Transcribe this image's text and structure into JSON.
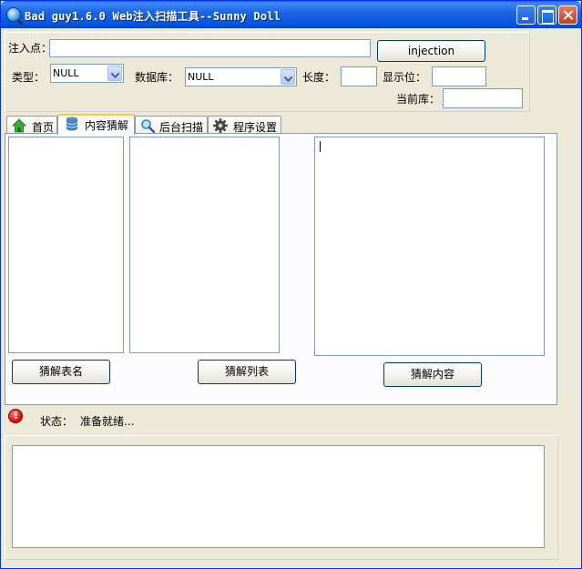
{
  "window": {
    "title": "Bad guy1.6.0 Web注入扫描工具--Sunny Doll"
  },
  "form": {
    "inject_point_label": "注入点：",
    "inject_point_value": "",
    "injection_button": "injection",
    "type_label": "类型：",
    "type_value": "NULL",
    "database_label": "数据库：",
    "database_value": "NULL",
    "length_label": "长度：",
    "length_value": "",
    "display_pos_label": "显示位：",
    "display_pos_value": "",
    "current_db_label": "当前库：",
    "current_db_value": ""
  },
  "tabs": [
    {
      "label": "首页",
      "icon": "home-icon"
    },
    {
      "label": "内容猜解",
      "icon": "database-icon",
      "active": true
    },
    {
      "label": "后台扫描",
      "icon": "magnifier-icon"
    },
    {
      "label": "程序设置",
      "icon": "gear-icon"
    }
  ],
  "content_tab": {
    "guess_table_button": "猜解表名",
    "guess_column_button": "猜解列表",
    "guess_content_button": "猜解内容"
  },
  "status": {
    "label": "状态：",
    "value": "准备就绪..."
  },
  "colors": {
    "titlebar": "#0054e3",
    "window_bg": "#ece9d8",
    "active_tab_accent": "#ffc83c",
    "status_error": "#e01010"
  }
}
